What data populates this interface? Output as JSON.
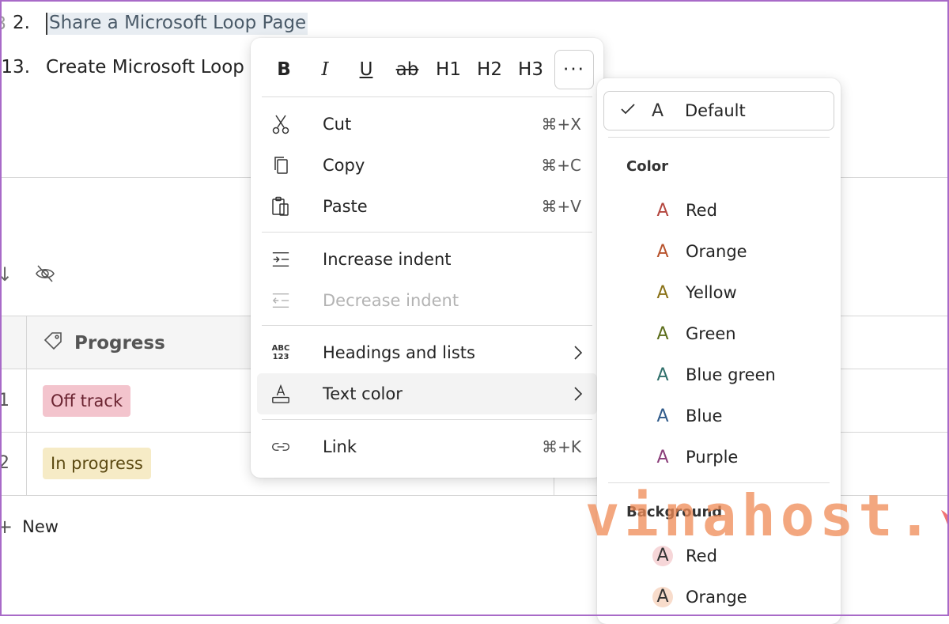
{
  "document": {
    "item_2": {
      "number": "2.",
      "text": "Share a Microsoft Loop Page"
    },
    "item_13": {
      "number": "13.",
      "text": "Create Microsoft Loop"
    },
    "edge_char": "3"
  },
  "table": {
    "header_progress": "Progress",
    "rows": [
      {
        "num": "1",
        "status": "Off track"
      },
      {
        "num": "2",
        "status": "In progress"
      }
    ],
    "new_label": "New"
  },
  "format_bar": {
    "bold": "B",
    "italic": "I",
    "underline": "U",
    "strike": "ab",
    "h1": "H1",
    "h2": "H2",
    "h3": "H3",
    "more": "···"
  },
  "context_menu": {
    "cut": {
      "label": "Cut",
      "shortcut": "⌘+X"
    },
    "copy": {
      "label": "Copy",
      "shortcut": "⌘+C"
    },
    "paste": {
      "label": "Paste",
      "shortcut": "⌘+V"
    },
    "increase_indent": {
      "label": "Increase indent"
    },
    "decrease_indent": {
      "label": "Decrease indent"
    },
    "headings_lists": {
      "label": "Headings and lists",
      "icon_text_1": "ABC",
      "icon_text_2": "123"
    },
    "text_color": {
      "label": "Text color"
    },
    "link": {
      "label": "Link",
      "shortcut": "⌘+K"
    }
  },
  "text_color_menu": {
    "default_label": "Default",
    "glyph": "A",
    "color_heading": "Color",
    "colors": [
      {
        "label": "Red",
        "hex": "#b4473f"
      },
      {
        "label": "Orange",
        "hex": "#b8542e"
      },
      {
        "label": "Yellow",
        "hex": "#8a7218"
      },
      {
        "label": "Green",
        "hex": "#5c6e1c"
      },
      {
        "label": "Blue green",
        "hex": "#2f6f6a"
      },
      {
        "label": "Blue",
        "hex": "#2f5a8a"
      },
      {
        "label": "Purple",
        "hex": "#8a3e7a"
      }
    ],
    "background_heading": "Background",
    "backgrounds": [
      {
        "label": "Red",
        "hex": "#f6d6d8"
      },
      {
        "label": "Orange",
        "hex": "#f8dccb"
      }
    ]
  },
  "watermark": {
    "text": "vinahost."
  },
  "colors": {
    "accent_border": "#a86ac8",
    "off_track_bg": "#f3c4cd",
    "in_progress_bg": "#f6ebc6",
    "watermark": "#f08a55",
    "watermark_check": "#ee5a5a"
  }
}
